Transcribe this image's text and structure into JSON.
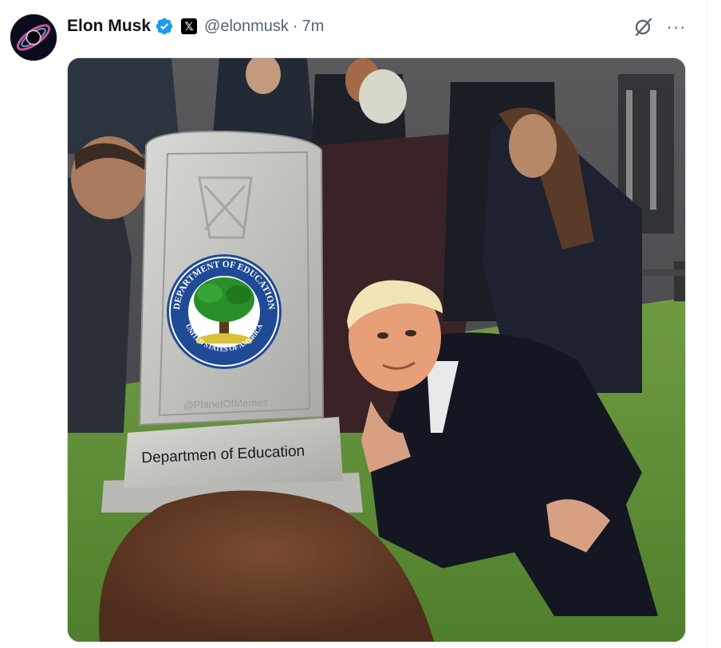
{
  "tweet": {
    "author_name": "Elon Musk",
    "verified_icon": "verified-badge-icon",
    "affiliation_icon": "x-logo-icon",
    "affiliation_glyph": "𝕏",
    "handle": "@elonmusk",
    "separator": "·",
    "timestamp": "7m",
    "more_glyph": "···",
    "colors": {
      "verified": "#1d9bf0",
      "secondary_text": "#536471",
      "border": "#cfd9de"
    }
  },
  "media": {
    "gravestone_caption": "Departmen of Education",
    "watermark": "@PlanetOfMemes",
    "seal_top_text": "DEPARTMENT OF EDUCATION",
    "seal_bottom_text": "UNITED STATES OF AMERICA"
  }
}
